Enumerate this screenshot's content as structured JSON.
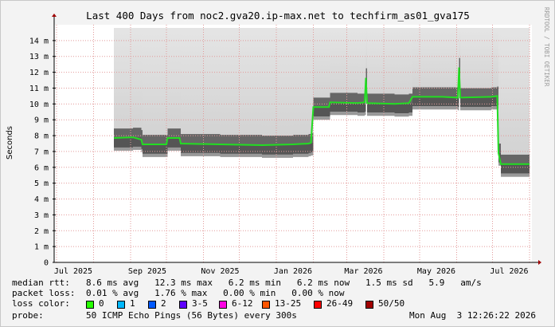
{
  "chart_data": {
    "type": "line",
    "title": "Last 400 Days from noc2.gva20.ip-max.net to techfirm_as01_gva175",
    "ylabel": "Seconds",
    "ylim": [
      0,
      0.015
    ],
    "y_ticks": [
      {
        "v": 0,
        "label": "0"
      },
      {
        "v": 0.001,
        "label": "1 m"
      },
      {
        "v": 0.002,
        "label": "2 m"
      },
      {
        "v": 0.003,
        "label": "3 m"
      },
      {
        "v": 0.004,
        "label": "4 m"
      },
      {
        "v": 0.005,
        "label": "5 m"
      },
      {
        "v": 0.006,
        "label": "6 m"
      },
      {
        "v": 0.007,
        "label": "7 m"
      },
      {
        "v": 0.008,
        "label": "8 m"
      },
      {
        "v": 0.009,
        "label": "9 m"
      },
      {
        "v": 0.01,
        "label": "10 m"
      },
      {
        "v": 0.011,
        "label": "11 m"
      },
      {
        "v": 0.012,
        "label": "12 m"
      },
      {
        "v": 0.013,
        "label": "13 m"
      },
      {
        "v": 0.014,
        "label": "14 m"
      }
    ],
    "xlim": [
      "2025-06-29",
      "2026-08-03"
    ],
    "x_ticks": [
      {
        "date": "2025-07-15",
        "label": "Jul 2025"
      },
      {
        "date": "2025-09-15",
        "label": "Sep 2025"
      },
      {
        "date": "2025-11-15",
        "label": "Nov 2025"
      },
      {
        "date": "2026-01-15",
        "label": "Jan 2026"
      },
      {
        "date": "2026-03-15",
        "label": "Mar 2026"
      },
      {
        "date": "2026-05-15",
        "label": "May 2026"
      },
      {
        "date": "2026-07-15",
        "label": "Jul 2026"
      }
    ],
    "x_grid_dates": [
      "2025-07-01",
      "2025-08-01",
      "2025-09-01",
      "2025-10-01",
      "2025-11-01",
      "2025-12-01",
      "2026-01-01",
      "2026-02-01",
      "2026-03-01",
      "2026-04-01",
      "2026-05-01",
      "2026-06-01",
      "2026-07-01",
      "2026-08-01"
    ],
    "grid": true,
    "series": [
      {
        "color": "#22dd22",
        "points": [
          {
            "date": "2025-08-18",
            "value": 0.00785
          },
          {
            "date": "2025-09-03",
            "value": 0.0079
          },
          {
            "date": "2025-09-10",
            "value": 0.00775
          },
          {
            "date": "2025-09-11",
            "value": 0.00745
          },
          {
            "date": "2025-10-01",
            "value": 0.00745
          },
          {
            "date": "2025-10-02",
            "value": 0.00785
          },
          {
            "date": "2025-10-12",
            "value": 0.00785
          },
          {
            "date": "2025-10-13",
            "value": 0.0075
          },
          {
            "date": "2025-11-15",
            "value": 0.00745
          },
          {
            "date": "2025-12-20",
            "value": 0.0074
          },
          {
            "date": "2026-01-15",
            "value": 0.00745
          },
          {
            "date": "2026-01-28",
            "value": 0.0075
          },
          {
            "date": "2026-01-30",
            "value": 0.00755
          },
          {
            "date": "2026-02-01",
            "value": 0.0098
          },
          {
            "date": "2026-02-14",
            "value": 0.0098
          },
          {
            "date": "2026-02-15",
            "value": 0.0101
          },
          {
            "date": "2026-03-10",
            "value": 0.01005
          },
          {
            "date": "2026-03-16",
            "value": 0.0101
          },
          {
            "date": "2026-03-17",
            "value": 0.01165
          },
          {
            "date": "2026-03-18",
            "value": 0.01005
          },
          {
            "date": "2026-04-10",
            "value": 0.01
          },
          {
            "date": "2026-04-22",
            "value": 0.01005
          },
          {
            "date": "2026-04-25",
            "value": 0.01045
          },
          {
            "date": "2026-05-20",
            "value": 0.01045
          },
          {
            "date": "2026-06-02",
            "value": 0.0104
          },
          {
            "date": "2026-06-03",
            "value": 0.0123
          },
          {
            "date": "2026-06-04",
            "value": 0.0104
          },
          {
            "date": "2026-06-30",
            "value": 0.01045
          },
          {
            "date": "2026-07-05",
            "value": 0.0105
          },
          {
            "date": "2026-07-06",
            "value": 0.0069
          },
          {
            "date": "2026-07-08",
            "value": 0.0062
          },
          {
            "date": "2026-08-01",
            "value": 0.0062
          }
        ]
      }
    ]
  },
  "watermark": "RRDTOOL / TOBI OETIKER",
  "stats": {
    "rtt_label": "median rtt:",
    "rtt_values": "8.6 ms avg   12.3 ms max   6.2 ms min   6.2 ms now   1.5 ms sd   5.9   am/s",
    "loss_label": "packet loss:",
    "loss_values": "0.01 % avg   1.76 % max   0.00 % min   0.00 % now",
    "color_label": "loss color:",
    "probe_label": "probe:",
    "probe_value": "50 ICMP Echo Pings (56 Bytes) every 300s",
    "timestamp": "Mon Aug  3 12:26:22 2026"
  },
  "loss_legend": [
    {
      "label": "0",
      "color": "#26ff00"
    },
    {
      "label": "1",
      "color": "#00b8ff"
    },
    {
      "label": "2",
      "color": "#0059ff"
    },
    {
      "label": "3-5",
      "color": "#5e00ff"
    },
    {
      "label": "6-12",
      "color": "#ff00e2"
    },
    {
      "label": "13-25",
      "color": "#ff5500"
    },
    {
      "label": "26-49",
      "color": "#ff0000"
    },
    {
      "label": "50/50",
      "color": "#a10000"
    }
  ]
}
